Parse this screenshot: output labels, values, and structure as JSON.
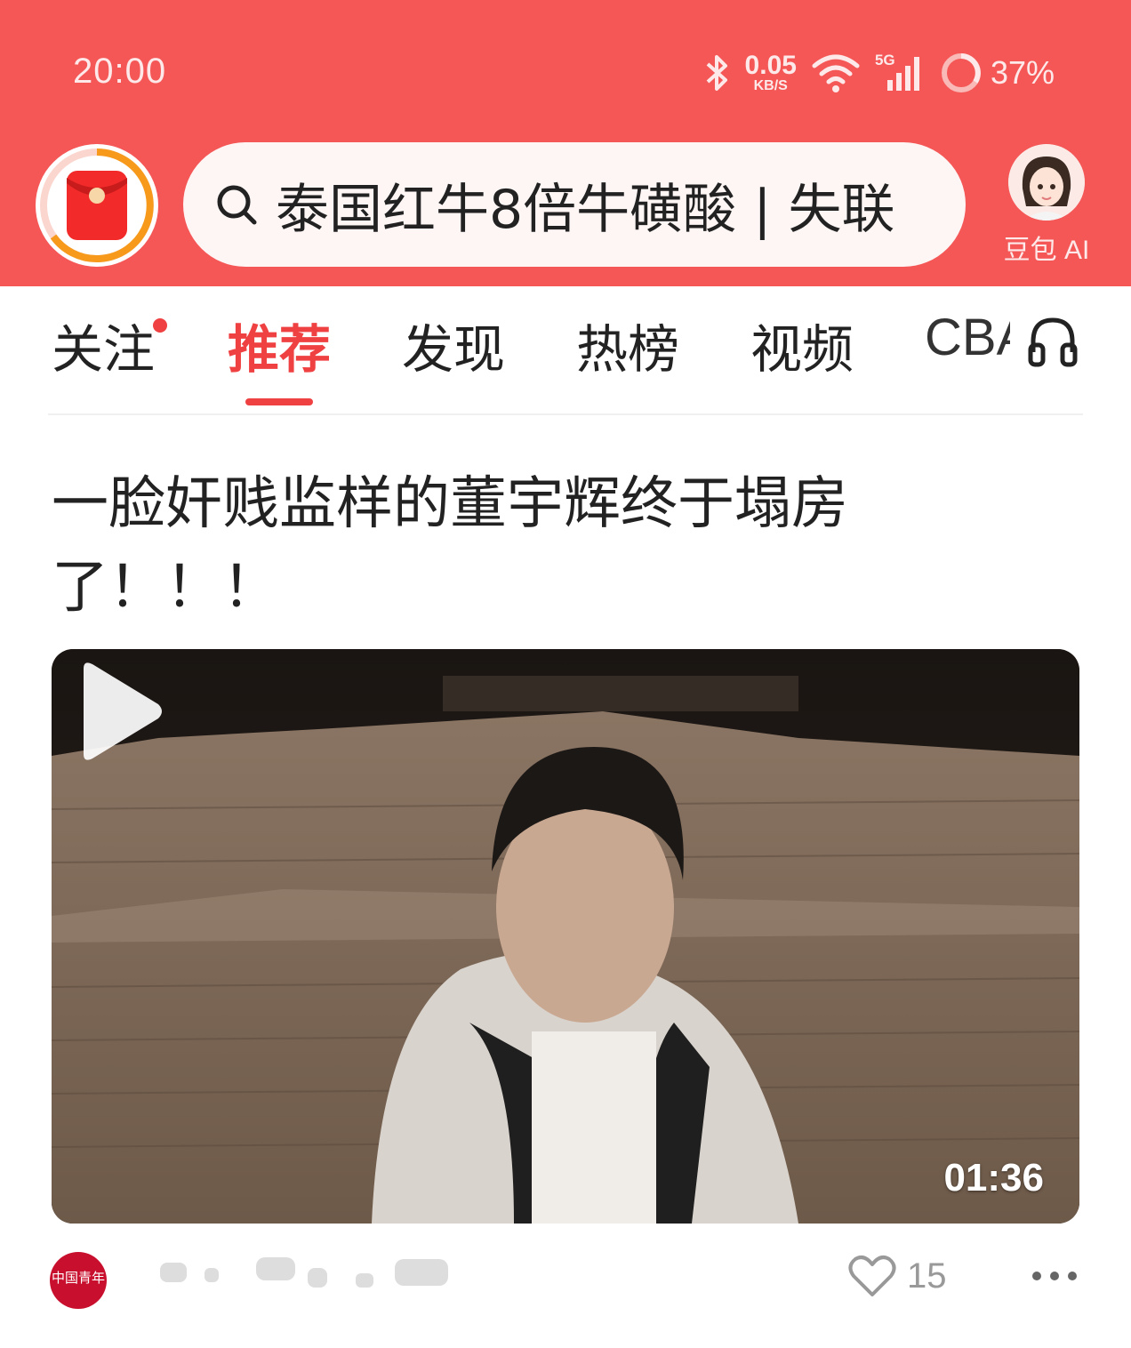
{
  "status_bar": {
    "time": "20:00",
    "net_speed_value": "0.05",
    "net_speed_unit": "KB/S",
    "network_type": "5G",
    "battery": "37%"
  },
  "header": {
    "search_text": "泰国红牛8倍牛磺酸 | 失联",
    "assistant_label": "豆包 AI",
    "background_color": "#f55757"
  },
  "tabs": [
    {
      "label": "关注",
      "has_dot": true
    },
    {
      "label": "推荐",
      "active": true
    },
    {
      "label": "发现"
    },
    {
      "label": "热榜"
    },
    {
      "label": "视频"
    },
    {
      "label": "CBA"
    }
  ],
  "article": {
    "title": "一脸奸贱监样的董宇辉终于塌房了！！！",
    "video_duration": "01:36",
    "source_logo_text": "中国青年",
    "likes": "15"
  },
  "icons": [
    "bluetooth-icon",
    "wifi-icon",
    "signal-icon",
    "battery-icon",
    "search-icon",
    "headset-icon",
    "play-icon",
    "heart-icon",
    "more-icon"
  ]
}
